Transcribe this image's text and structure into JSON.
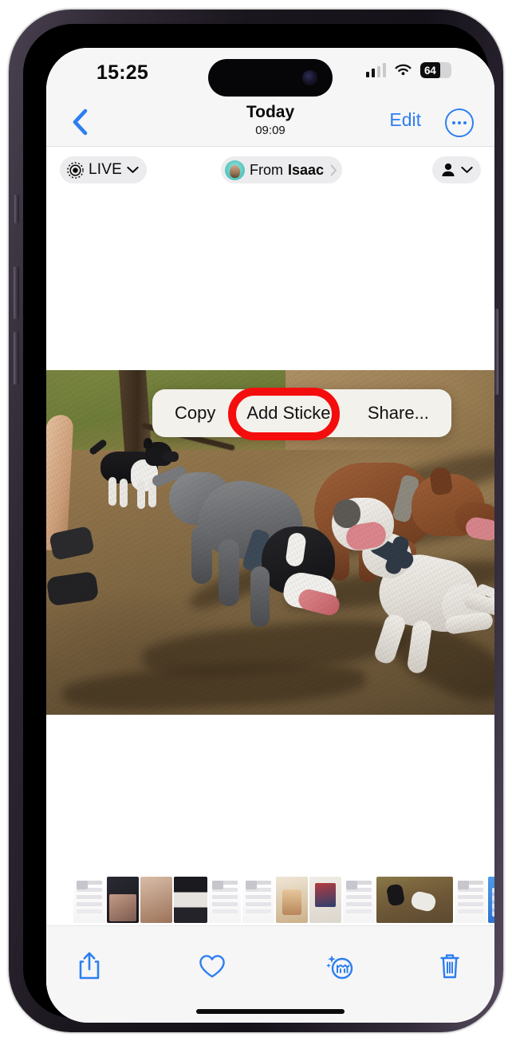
{
  "device": {
    "buttons": [
      "mute-switch",
      "volume-up",
      "volume-down",
      "power"
    ],
    "frame_color": "#2e2833"
  },
  "status_bar": {
    "time": "15:25",
    "cellular_icon": "cellular-signal-icon",
    "cellular_bars_filled": 2,
    "cellular_bars_total": 4,
    "wifi_icon": "wifi-icon",
    "battery_percent": "64",
    "battery_fill_ratio": 0.64
  },
  "nav_bar": {
    "back_icon": "chevron-left-icon",
    "title": "Today",
    "subtitle": "09:09",
    "edit_label": "Edit",
    "more_icon": "ellipsis-circle-icon"
  },
  "badge_row": {
    "live": {
      "icon": "live-photo-icon",
      "label": "LIVE",
      "chevron_icon": "chevron-down-icon"
    },
    "sender": {
      "avatar_icon": "contact-avatar",
      "from_label": "From",
      "name": "Isaac",
      "chevron_icon": "chevron-right-icon"
    },
    "people": {
      "icon": "person-icon",
      "chevron_icon": "chevron-down-icon"
    }
  },
  "context_menu": {
    "items": [
      {
        "label": "Copy",
        "highlighted": false
      },
      {
        "label": "Add Sticker",
        "highlighted": true
      },
      {
        "label": "Share...",
        "highlighted": false
      }
    ],
    "highlight_color": "#f40d0d",
    "background_color": "#f2f1ec"
  },
  "photo": {
    "description": "Four dogs playing in a dirt dog park with a tree and a person's sandaled feet at left",
    "alt": "dogs-at-park-photo"
  },
  "filmstrip": {
    "thumbnails": [
      {
        "kind": "partial-left",
        "name": "thumbnail-partial"
      },
      {
        "kind": "doc",
        "name": "thumbnail-document"
      },
      {
        "kind": "photo-dark",
        "name": "thumbnail-photo-dark"
      },
      {
        "kind": "photo-hands",
        "name": "thumbnail-photo-hands"
      },
      {
        "kind": "photo-strip",
        "name": "thumbnail-photo-strip"
      },
      {
        "kind": "doc",
        "name": "thumbnail-document"
      },
      {
        "kind": "doc",
        "name": "thumbnail-document"
      },
      {
        "kind": "photo-drinks",
        "name": "thumbnail-photo-drinks"
      },
      {
        "kind": "photo-poster",
        "name": "thumbnail-photo-poster"
      },
      {
        "kind": "doc",
        "name": "thumbnail-document"
      },
      {
        "kind": "photo-dogs",
        "name": "thumbnail-photo-dogs-selected",
        "selected": true
      },
      {
        "kind": "doc",
        "name": "thumbnail-document"
      },
      {
        "kind": "ui-blue",
        "name": "thumbnail-home-screen"
      },
      {
        "kind": "ui-list",
        "name": "thumbnail-settings-list"
      },
      {
        "kind": "ui-profile",
        "name": "thumbnail-profile-screen"
      },
      {
        "kind": "ui-yellow",
        "name": "thumbnail-note-screen"
      },
      {
        "kind": "ui-profile",
        "name": "thumbnail-profile-screen"
      },
      {
        "kind": "ui-profile",
        "name": "thumbnail-profile-screen"
      },
      {
        "kind": "ui-profile",
        "name": "thumbnail-profile-screen"
      },
      {
        "kind": "partial-right",
        "name": "thumbnail-partial"
      }
    ]
  },
  "bottom_toolbar": {
    "accent_color": "#2d7ff0",
    "buttons": [
      {
        "name": "share-button",
        "icon": "share-icon"
      },
      {
        "name": "favorite-button",
        "icon": "heart-icon"
      },
      {
        "name": "visual-lookup-button",
        "icon": "visual-lookup-dog-icon"
      },
      {
        "name": "delete-button",
        "icon": "trash-icon"
      }
    ]
  }
}
